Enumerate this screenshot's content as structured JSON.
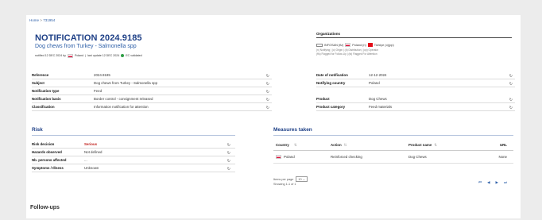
{
  "breadcrumb": {
    "home": "Home",
    "sep": ">",
    "current": "731954"
  },
  "notification": {
    "title": "NOTIFICATION 2024.9185",
    "subtitle": "Dog chews from Turkey - Salmonella spp",
    "meta_prefix": "notified 12 DEC 2024 by",
    "meta_country": "Poland",
    "meta_update": "last update 12 DEC 2024",
    "meta_status": "EC validated"
  },
  "organizations": {
    "title": "Organizations",
    "row": [
      "INFOSAN (flz)",
      "Poland (n)",
      "Türkiye (o)(pp)"
    ],
    "legend_1": "(n) Notifying | (o) Origin | (d) Distribution | (op) Operator",
    "legend_2": "(ffu) Flagged for Follow-Up | (fa) Flagged For Attention"
  },
  "left_fields": [
    {
      "label": "Reference",
      "value": "2024.9185"
    },
    {
      "label": "Subject",
      "value": "Dog chews from Turkey - Salmonella spp"
    },
    {
      "label": "Notification type",
      "value": "Feed"
    },
    {
      "label": "Notification basis",
      "value": "Border control - consignment released"
    },
    {
      "label": "Classification",
      "value": "Information notification for attention"
    }
  ],
  "right_fields": [
    {
      "label": "Date of notification",
      "value": "12-12-2024"
    },
    {
      "label": "Notifying country",
      "value": "Poland"
    },
    {
      "label": "",
      "value": ""
    },
    {
      "label": "Product",
      "value": "Dog Chews"
    },
    {
      "label": "Product category",
      "value": "Feed materials"
    }
  ],
  "risk": {
    "title": "Risk",
    "rows": [
      {
        "label": "Risk decision",
        "value": "Serious"
      },
      {
        "label": "Hazards observed",
        "value": "Not defined"
      },
      {
        "label": "Nb. persons affected",
        "value": "..."
      },
      {
        "label": "Symptoms / Illness",
        "value": "Unknown"
      }
    ]
  },
  "measures": {
    "title": "Measures taken",
    "headers": [
      "Country",
      "Action",
      "Product name",
      "URL"
    ],
    "rows": [
      {
        "country": "Poland",
        "action": "Reinforced checking",
        "product": "Dog Chews",
        "url": "None"
      }
    ],
    "items_per_page_label": "Items per page",
    "items_per_page_value": "10",
    "showing": "Showing 1-1 of 1"
  },
  "followups": {
    "title": "Follow-ups"
  },
  "colors": {
    "title_blue": "#1d3f86",
    "link_blue": "#2d5fa8",
    "serious_red": "#c0201c",
    "validated_green": "#2e9e46"
  }
}
